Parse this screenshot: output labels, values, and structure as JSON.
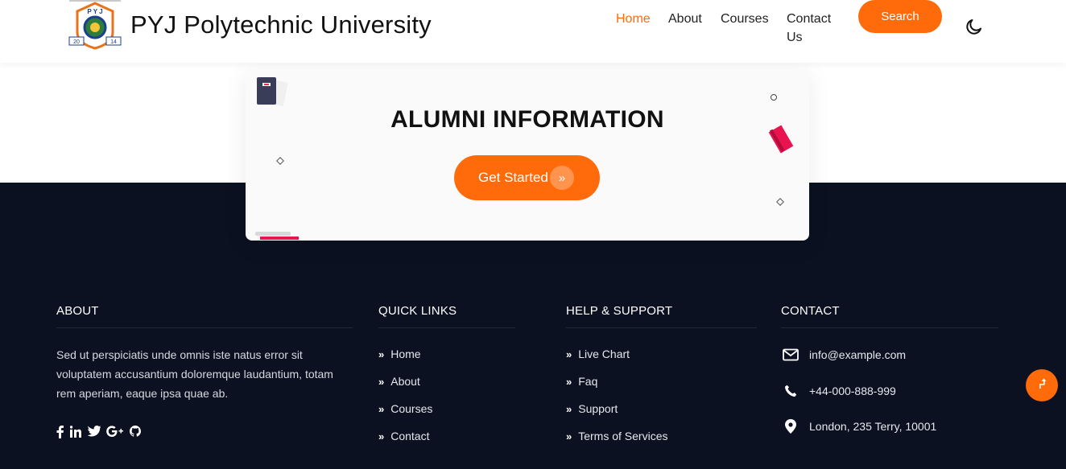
{
  "header": {
    "brand": "PYJ Polytechnic University",
    "logo_text": "P Y J",
    "logo_year_left": "20",
    "logo_year_right": "14",
    "nav": [
      {
        "label": "Home",
        "active": true
      },
      {
        "label": "About",
        "active": false
      },
      {
        "label": "Courses",
        "active": false
      },
      {
        "label": "Contact Us",
        "active": false
      }
    ],
    "search_label": "Search",
    "theme_icon": "moon-icon"
  },
  "hero": {
    "title": "ALUMNI INFORMATION",
    "cta_label": "Get Started",
    "cta_icon": "double-chevron-right-icon"
  },
  "footer": {
    "about": {
      "heading": "ABOUT",
      "text": "Sed ut perspiciatis unde omnis iste natus error sit voluptatem accusantium doloremque laudantium, totam rem aperiam, eaque ipsa quae ab.",
      "social": [
        "facebook-icon",
        "linkedin-icon",
        "twitter-icon",
        "google-plus-icon",
        "github-icon"
      ]
    },
    "quick_links": {
      "heading": "QUICK LINKS",
      "items": [
        "Home",
        "About",
        "Courses",
        "Contact"
      ]
    },
    "help": {
      "heading": "HELP & SUPPORT",
      "items": [
        "Live Chart",
        "Faq",
        "Support",
        "Terms of Services"
      ]
    },
    "contact": {
      "heading": "CONTACT",
      "email": "info@example.com",
      "phone": "+44-000-888-999",
      "address": "London, 235 Terry, 10001"
    }
  },
  "colors": {
    "accent": "#ff6b0a",
    "footer_bg": "#0b1120",
    "card_bg": "#fafafa"
  }
}
